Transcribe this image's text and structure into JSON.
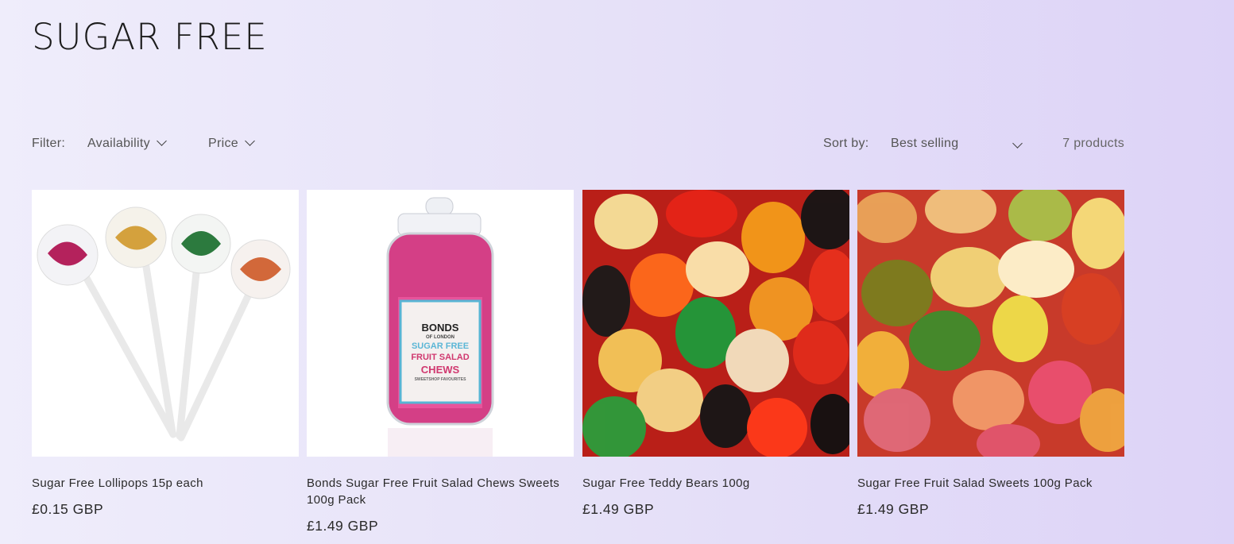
{
  "collection": {
    "title": "SUGAR FREE"
  },
  "filters": {
    "label": "Filter:",
    "availability": "Availability",
    "price": "Price"
  },
  "sort": {
    "label": "Sort by:",
    "selected": "Best selling"
  },
  "product_count": "7 products",
  "products": [
    {
      "name": "Sugar Free Lollipops 15p each",
      "price": "£0.15 GBP",
      "image": "lollipops"
    },
    {
      "name": "Bonds Sugar Free Fruit Salad Chews Sweets 100g Pack",
      "price": "£1.49 GBP",
      "image": "jar-of-chews",
      "label_lines": [
        "BONDS",
        "OF LONDON",
        "SUGAR FREE",
        "FRUIT SALAD",
        "CHEWS",
        "SWEETSHOP FAVOURITES"
      ]
    },
    {
      "name": "Sugar Free Teddy Bears 100g",
      "price": "£1.49 GBP",
      "image": "teddy-bear-gummies"
    },
    {
      "name": "Sugar Free Fruit Salad Sweets 100g Pack",
      "price": "£1.49 GBP",
      "image": "fruit-gummies"
    }
  ]
}
